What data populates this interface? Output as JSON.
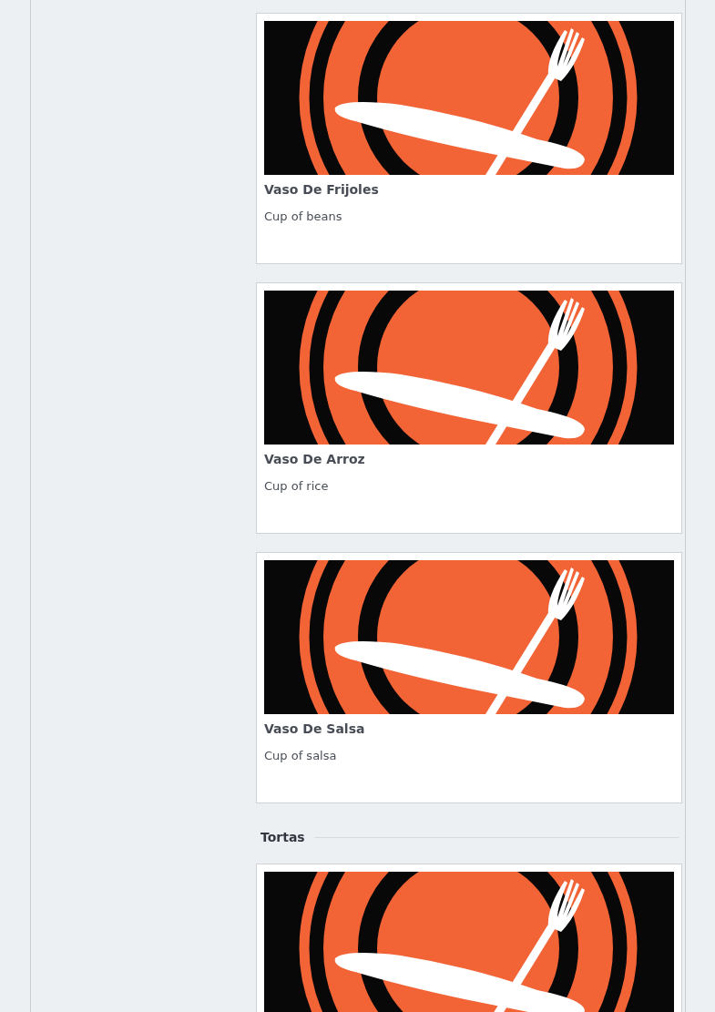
{
  "sections": [
    {
      "items": [
        {
          "name": "Vaso De Frijoles",
          "description": "Cup of beans"
        },
        {
          "name": "Vaso De Arroz",
          "description": "Cup of rice"
        },
        {
          "name": "Vaso De Salsa",
          "description": "Cup of salsa"
        }
      ]
    },
    {
      "heading": "Tortas",
      "cut_off_card": true
    }
  ]
}
